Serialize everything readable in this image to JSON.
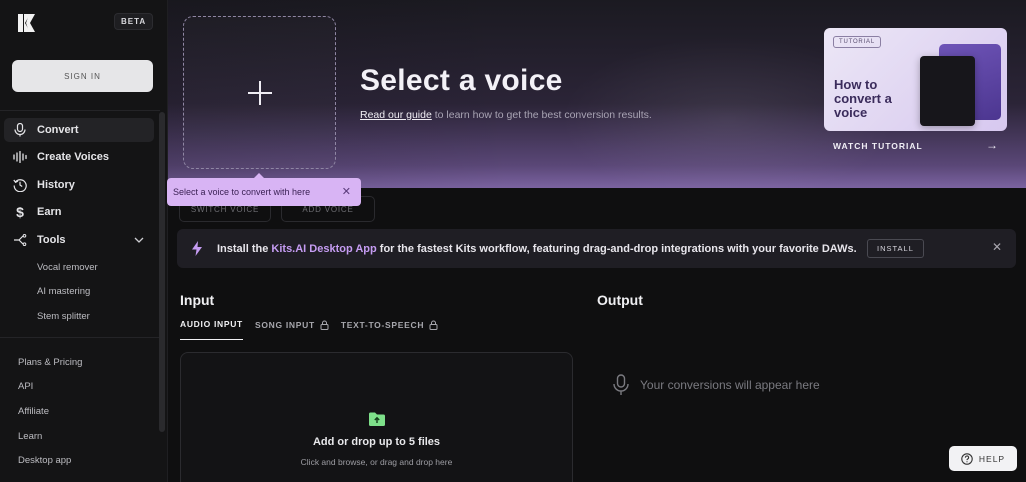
{
  "sidebar": {
    "beta": "BETA",
    "signin": "SIGN IN",
    "nav": [
      {
        "label": "Convert",
        "icon": "mic-icon"
      },
      {
        "label": "Create Voices",
        "icon": "waveform-icon"
      },
      {
        "label": "History",
        "icon": "history-icon"
      },
      {
        "label": "Earn",
        "icon": "dollar-icon"
      },
      {
        "label": "Tools",
        "icon": "tools-icon"
      }
    ],
    "tools": [
      "Vocal remover",
      "AI mastering",
      "Stem splitter"
    ],
    "lower": [
      "Plans & Pricing",
      "API",
      "Affiliate",
      "Learn",
      "Desktop app"
    ]
  },
  "hero": {
    "title": "Select a voice",
    "guide_link": "Read our guide",
    "guide_rest": " to learn how to get the best conversion results.",
    "tutorial_badge": "TUTORIAL",
    "tutorial_text": "How to convert a voice",
    "watch": "WATCH TUTORIAL"
  },
  "tooltip": {
    "text": "Select a voice to convert with here"
  },
  "ghost_buttons": [
    "SWITCH VOICE",
    "ADD VOICE"
  ],
  "banner": {
    "pre": "Install the ",
    "highlight": "Kits.AI Desktop App",
    "post": " for the fastest Kits workflow, featuring drag-and-drop integrations with your favorite DAWs.",
    "install": "INSTALL"
  },
  "input": {
    "title": "Input",
    "tabs": [
      "AUDIO INPUT",
      "SONG INPUT",
      "TEXT-TO-SPEECH"
    ],
    "drop_title": "Add or drop up to 5 files",
    "drop_sub": "Click and browse, or drag and drop here"
  },
  "output": {
    "title": "Output",
    "empty": "Your conversions will appear here"
  },
  "help": "HELP"
}
